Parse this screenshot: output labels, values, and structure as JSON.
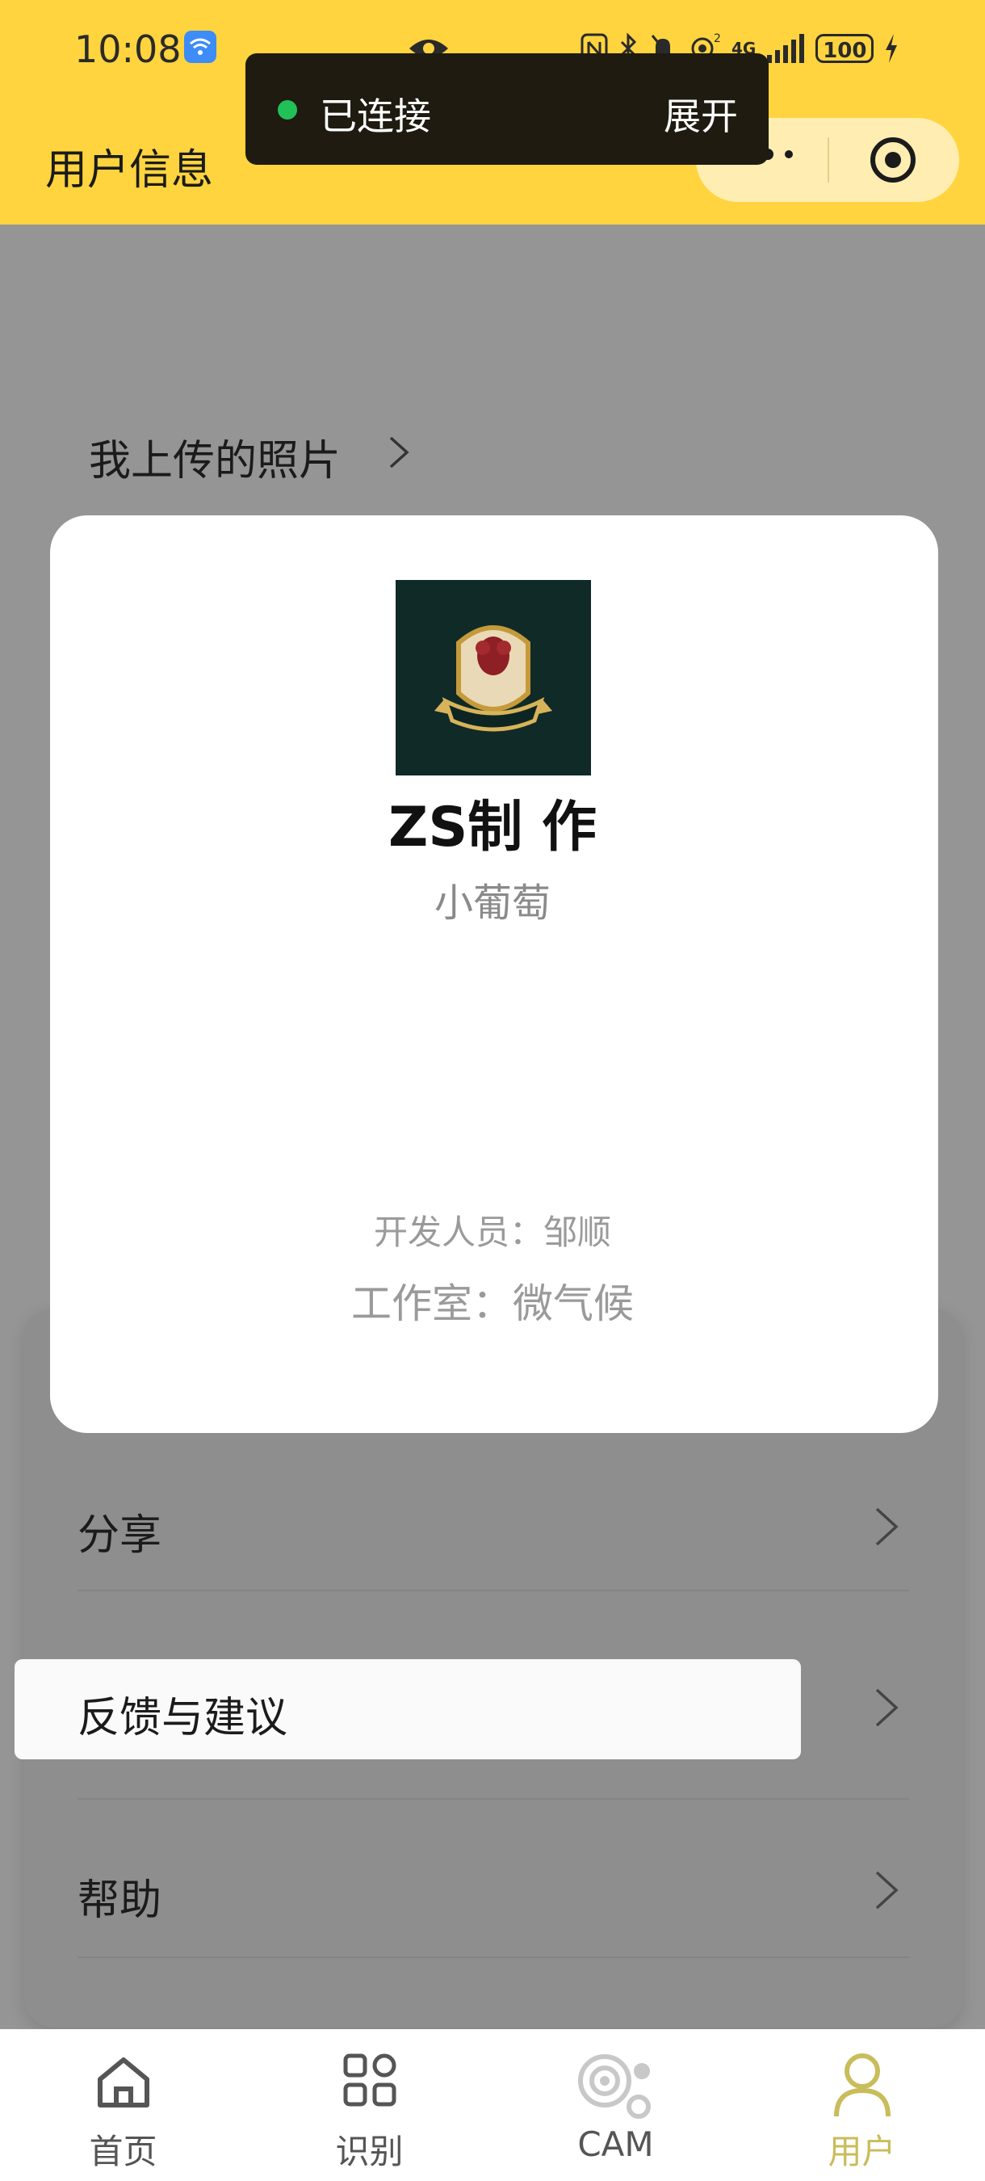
{
  "status_bar": {
    "time": "10:08",
    "battery": "100",
    "signal": "4G"
  },
  "header": {
    "title": "用户信息",
    "capsule": {
      "more_icon": "more-dots-icon",
      "close_icon": "target-circle-icon"
    }
  },
  "toast": {
    "status": "已连接",
    "action": "展开"
  },
  "background": {
    "uploads_label": "我上传的照片",
    "menu": [
      {
        "label": "分享"
      },
      {
        "label": "反馈与建议"
      },
      {
        "label": "帮助"
      }
    ]
  },
  "modal": {
    "name": "ZS制 作",
    "subtitle": "小葡萄",
    "developer": "开发人员：邹顺",
    "studio": "工作室：微气候"
  },
  "tabbar": {
    "tabs": [
      {
        "label": "首页",
        "icon": "home-icon",
        "active": false
      },
      {
        "label": "识别",
        "icon": "grid-icon",
        "active": false
      },
      {
        "label": "CAM",
        "icon": "cam-icon",
        "active": false
      },
      {
        "label": "用户",
        "icon": "user-icon",
        "active": true
      }
    ]
  },
  "colors": {
    "header_bg": "#FFD43F",
    "toast_bg": "#1F1B10",
    "connected_dot": "#21C15A",
    "active_tab": "#C9BC5B"
  }
}
